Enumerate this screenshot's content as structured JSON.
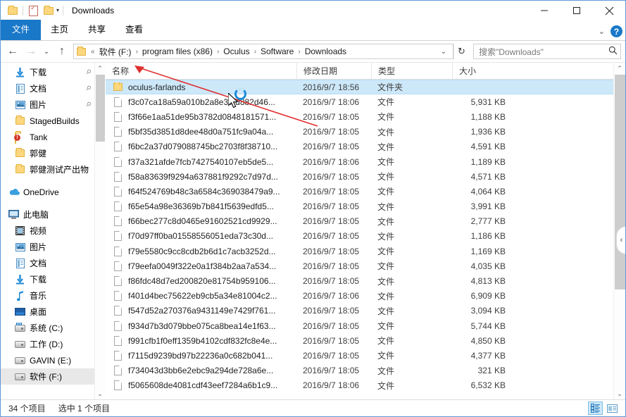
{
  "window": {
    "title": "Downloads",
    "controls": {
      "minimize": "minimize-icon",
      "maximize": "maximize-icon",
      "close": "close-icon"
    },
    "quick_access": [
      "folder-icon",
      "properties-icon",
      "new-folder-icon",
      "customize-chevron-icon"
    ]
  },
  "ribbon": {
    "tabs": [
      {
        "label": "文件",
        "active": true
      },
      {
        "label": "主页",
        "active": false
      },
      {
        "label": "共享",
        "active": false
      },
      {
        "label": "查看",
        "active": false
      }
    ],
    "expand_icon": "chevron-down-icon",
    "help_label": "?"
  },
  "address": {
    "back_icon": "←",
    "forward_icon": "→",
    "recent_icon": "⌄",
    "up_icon": "↑",
    "overflow": "«",
    "crumbs": [
      "软件 (F:)",
      "program files (x86)",
      "Oculus",
      "Software",
      "Downloads"
    ],
    "separator": "›",
    "dropdown_icon": "⌄",
    "refresh_icon": "↻"
  },
  "search": {
    "placeholder": "搜索\"Downloads\"",
    "icon": "search-icon"
  },
  "sidebar": {
    "groups": [
      {
        "items": [
          {
            "label": "下载",
            "icon": "download-icon",
            "pinned": true
          },
          {
            "label": "文档",
            "icon": "documents-icon",
            "pinned": true
          },
          {
            "label": "图片",
            "icon": "pictures-icon",
            "pinned": true
          },
          {
            "label": "StagedBuilds",
            "icon": "folder-icon",
            "pinned": false
          },
          {
            "label": "Tank",
            "icon": "folder-alert-icon",
            "pinned": false
          },
          {
            "label": "郭健",
            "icon": "folder-icon",
            "pinned": false
          },
          {
            "label": "郭健测试产出物",
            "icon": "folder-icon",
            "pinned": false
          }
        ]
      },
      {
        "items": [
          {
            "label": "OneDrive",
            "icon": "onedrive-icon",
            "pinned": false,
            "root": true
          }
        ]
      },
      {
        "items": [
          {
            "label": "此电脑",
            "icon": "this-pc-icon",
            "pinned": false,
            "root": true
          },
          {
            "label": "视频",
            "icon": "videos-icon",
            "pinned": false
          },
          {
            "label": "图片",
            "icon": "pictures-icon",
            "pinned": false
          },
          {
            "label": "文档",
            "icon": "documents-icon",
            "pinned": false
          },
          {
            "label": "下载",
            "icon": "download-icon",
            "pinned": false
          },
          {
            "label": "音乐",
            "icon": "music-icon",
            "pinned": false
          },
          {
            "label": "桌面",
            "icon": "desktop-icon",
            "pinned": false
          },
          {
            "label": "系统 (C:)",
            "icon": "system-drive-icon",
            "pinned": false
          },
          {
            "label": "工作 (D:)",
            "icon": "drive-icon",
            "pinned": false
          },
          {
            "label": "GAVIN (E:)",
            "icon": "drive-icon",
            "pinned": false
          },
          {
            "label": "软件 (F:)",
            "icon": "drive-icon",
            "pinned": false,
            "selected": true
          }
        ]
      }
    ]
  },
  "columns": [
    {
      "key": "name",
      "label": "名称"
    },
    {
      "key": "date",
      "label": "修改日期"
    },
    {
      "key": "type",
      "label": "类型"
    },
    {
      "key": "size",
      "label": "大小"
    }
  ],
  "files": [
    {
      "name": "oculus-farlands",
      "date": "2016/9/7 18:56",
      "type": "文件夹",
      "size": "",
      "icon": "folder-icon",
      "selected": true
    },
    {
      "name": "f3c07ca18a59a010b2a8e3afd882d46...",
      "date": "2016/9/7 18:06",
      "type": "文件",
      "size": "5,931 KB",
      "icon": "file-icon",
      "selected": false
    },
    {
      "name": "f3f66e1aa51de95b3782d0848181571...",
      "date": "2016/9/7 18:05",
      "type": "文件",
      "size": "1,188 KB",
      "icon": "file-icon",
      "selected": false
    },
    {
      "name": "f5bf35d3851d8dee48d0a751fc9a04a...",
      "date": "2016/9/7 18:05",
      "type": "文件",
      "size": "1,936 KB",
      "icon": "file-icon",
      "selected": false
    },
    {
      "name": "f6bc2a37d079088745bc2703f8f38710...",
      "date": "2016/9/7 18:05",
      "type": "文件",
      "size": "4,591 KB",
      "icon": "file-icon",
      "selected": false
    },
    {
      "name": "f37a321afde7fcb7427540107eb5de5...",
      "date": "2016/9/7 18:06",
      "type": "文件",
      "size": "1,189 KB",
      "icon": "file-icon",
      "selected": false
    },
    {
      "name": "f58a83639f9294a637881f9292c7d97d...",
      "date": "2016/9/7 18:05",
      "type": "文件",
      "size": "4,571 KB",
      "icon": "file-icon",
      "selected": false
    },
    {
      "name": "f64f524769b48c3a6584c369038479a9...",
      "date": "2016/9/7 18:05",
      "type": "文件",
      "size": "4,064 KB",
      "icon": "file-icon",
      "selected": false
    },
    {
      "name": "f65e54a98e36369b7b841f5639edfd5...",
      "date": "2016/9/7 18:05",
      "type": "文件",
      "size": "3,991 KB",
      "icon": "file-icon",
      "selected": false
    },
    {
      "name": "f66bec277c8d0465e91602521cd9929...",
      "date": "2016/9/7 18:05",
      "type": "文件",
      "size": "2,777 KB",
      "icon": "file-icon",
      "selected": false
    },
    {
      "name": "f70d97ff0ba01558556051eda73c30d...",
      "date": "2016/9/7 18:05",
      "type": "文件",
      "size": "1,186 KB",
      "icon": "file-icon",
      "selected": false
    },
    {
      "name": "f79e5580c9cc8cdb2b6d1c7acb3252d...",
      "date": "2016/9/7 18:05",
      "type": "文件",
      "size": "1,169 KB",
      "icon": "file-icon",
      "selected": false
    },
    {
      "name": "f79eefa0049f322e0a1f384b2aa7a534...",
      "date": "2016/9/7 18:05",
      "type": "文件",
      "size": "4,035 KB",
      "icon": "file-icon",
      "selected": false
    },
    {
      "name": "f86fdc48d7ed200820e81754b959106...",
      "date": "2016/9/7 18:05",
      "type": "文件",
      "size": "4,813 KB",
      "icon": "file-icon",
      "selected": false
    },
    {
      "name": "f401d4bec75622eb9cb5a34e81004c2...",
      "date": "2016/9/7 18:06",
      "type": "文件",
      "size": "6,909 KB",
      "icon": "file-icon",
      "selected": false
    },
    {
      "name": "f547d52a270376a9431149e7429f761...",
      "date": "2016/9/7 18:05",
      "type": "文件",
      "size": "3,094 KB",
      "icon": "file-icon",
      "selected": false
    },
    {
      "name": "f934d7b3d079bbe075ca8bea14e1f63...",
      "date": "2016/9/7 18:05",
      "type": "文件",
      "size": "5,744 KB",
      "icon": "file-icon",
      "selected": false
    },
    {
      "name": "f991cfb1f0eff1359b4102cdf832fc8e4e...",
      "date": "2016/9/7 18:05",
      "type": "文件",
      "size": "4,850 KB",
      "icon": "file-icon",
      "selected": false
    },
    {
      "name": "f7115d9239bd97b22236a0c682b041...",
      "date": "2016/9/7 18:05",
      "type": "文件",
      "size": "4,377 KB",
      "icon": "file-icon",
      "selected": false
    },
    {
      "name": "f734043d3bb6e2ebc9a294de728a6e...",
      "date": "2016/9/7 18:05",
      "type": "文件",
      "size": "321 KB",
      "icon": "file-icon",
      "selected": false
    },
    {
      "name": "f5065608de4081cdf43eef7284a6b1c9...",
      "date": "2016/9/7 18:06",
      "type": "文件",
      "size": "6,532 KB",
      "icon": "file-icon",
      "selected": false
    }
  ],
  "status": {
    "item_count": "34 个项目",
    "selection": "选中 1 个项目",
    "views": [
      {
        "name": "details-view",
        "active": true
      },
      {
        "name": "large-icons-view",
        "active": false
      }
    ]
  },
  "annotation": {
    "arrow_color": "#e03030",
    "cursor": "arrow-busy-cursor"
  },
  "colors": {
    "accent": "#1a78c8",
    "selection": "#cde8f9",
    "folder": "#fcd77f"
  }
}
